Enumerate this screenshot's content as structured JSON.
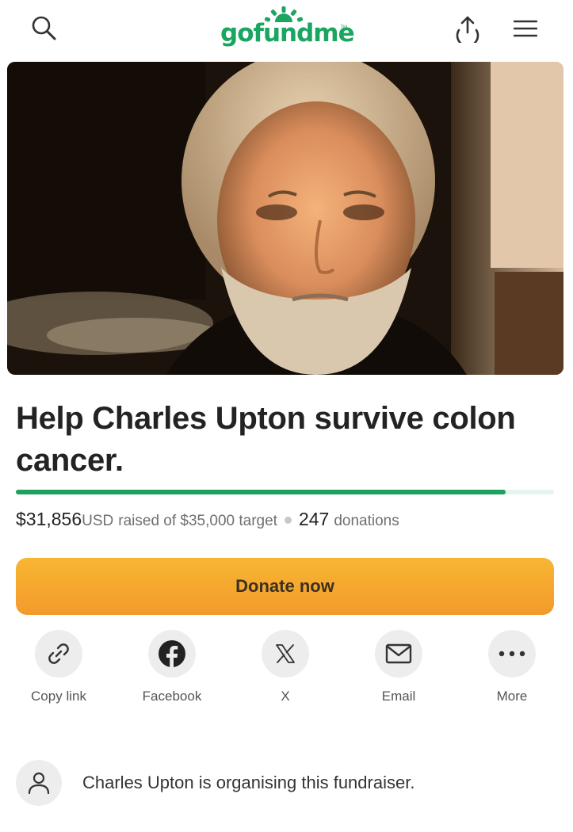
{
  "header": {
    "logo_text": "gofundme",
    "logo_tm": "TM",
    "search_icon": "search-icon",
    "share_icon": "upload-share-icon",
    "menu_icon": "hamburger-menu-icon"
  },
  "campaign": {
    "title": "Help Charles Upton survive colon cancer.",
    "raised": "$31,856",
    "currency": "USD",
    "raised_suffix": "raised of $35,000 target",
    "donations_count": "247",
    "donations_label": "donations",
    "progress_fraction": 0.91
  },
  "donate_button": {
    "label": "Donate now"
  },
  "share_options": [
    {
      "label": "Copy link",
      "icon": "link-icon"
    },
    {
      "label": "Facebook",
      "icon": "facebook-icon"
    },
    {
      "label": "X",
      "icon": "x-icon"
    },
    {
      "label": "Email",
      "icon": "email-icon"
    },
    {
      "label": "More",
      "icon": "more-dots-icon"
    }
  ],
  "organiser": {
    "text": "Charles Upton is organising this fundraiser.",
    "icon": "person-icon"
  },
  "colors": {
    "brand_green": "#1aa560",
    "progress_green": "#1ea15e",
    "donate_orange_top": "#f8b632",
    "donate_orange_bottom": "#f29a2c"
  }
}
